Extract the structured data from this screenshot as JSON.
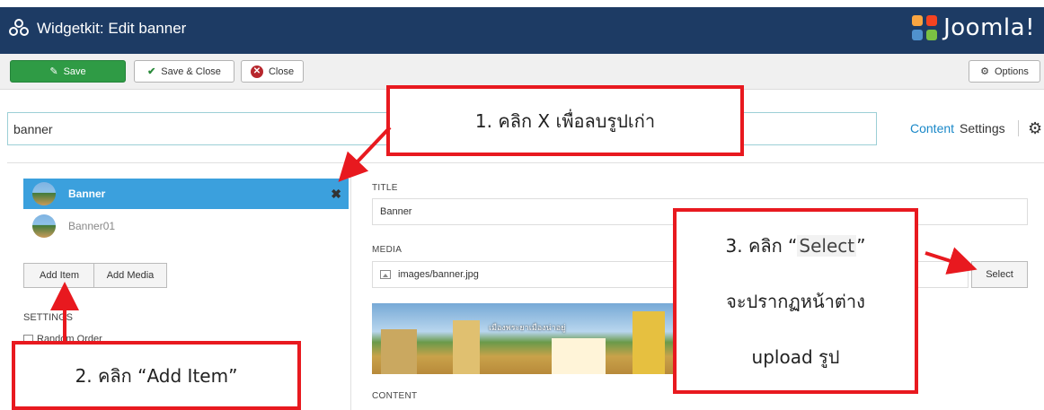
{
  "header": {
    "title": "Widgetkit: Edit banner",
    "brand": "Joomla!"
  },
  "toolbar": {
    "save": "Save",
    "save_close": "Save & Close",
    "close": "Close",
    "options": "Options"
  },
  "widget_name": {
    "value": "banner"
  },
  "top_nav": {
    "content": "Content",
    "settings": "Settings"
  },
  "items": [
    {
      "label": "Banner",
      "active": true
    },
    {
      "label": "Banner01",
      "active": false
    }
  ],
  "left_buttons": {
    "add_item": "Add Item",
    "add_media": "Add Media"
  },
  "settings": {
    "heading": "SETTINGS",
    "random_order": "Random Order"
  },
  "form": {
    "title_label": "TITLE",
    "title_value": "Banner",
    "media_label": "MEDIA",
    "media_value": "images/banner.jpg",
    "select_button": "Select",
    "content_label": "CONTENT"
  },
  "banner_caption": "เมืองพระยาเมืองน่าอยู่",
  "callouts": {
    "step1": "1. คลิก X เพื่อลบรูปเก่า",
    "step2": "2. คลิก “Add Item”",
    "step3_pre": "3. คลิก ",
    "step3_q_open": "“",
    "step3_word": "Select",
    "step3_q_close": "”",
    "step3_line2": "จะปรากฏหน้าต่าง",
    "step3_line3": "upload รูป"
  },
  "colors": {
    "header": "#1d3b64",
    "save": "#2f9b45",
    "active_item": "#3ba0dd",
    "callout_border": "#e8191f",
    "link": "#1a88c8"
  }
}
